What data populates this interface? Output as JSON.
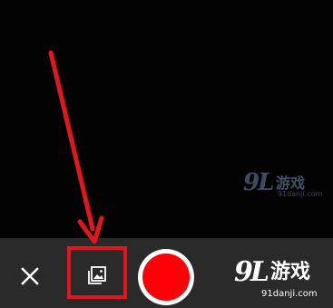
{
  "camera": {
    "close_icon": "close-icon",
    "gallery_icon": "gallery-icon",
    "record_icon": "record-icon"
  },
  "watermark": {
    "logo": "9L",
    "name": "游戏",
    "domain_small": "91danji.com",
    "domain_bottom": "91danji.com"
  },
  "colors": {
    "toolbar_bg": "#2a2a2a",
    "record_red": "#ff0008",
    "annotation_red": "#e3161b"
  }
}
